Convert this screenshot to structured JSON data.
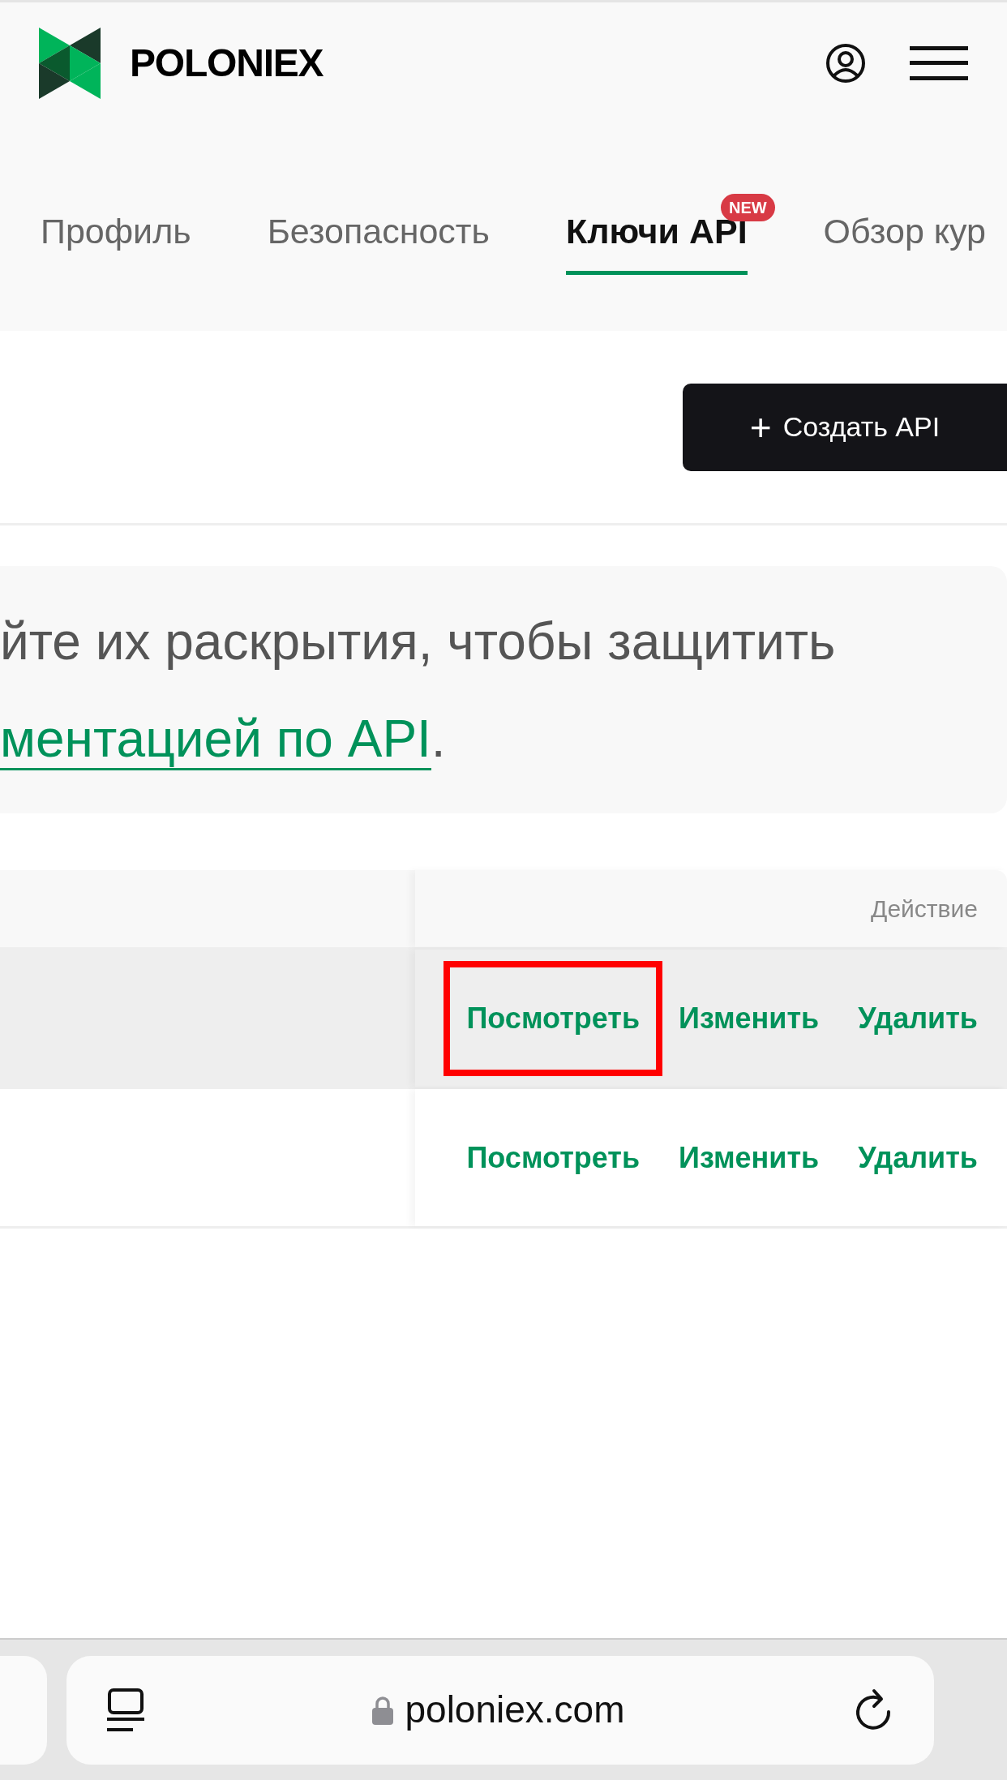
{
  "header": {
    "logo_text": "POLONIEX"
  },
  "tabs": [
    {
      "label": "Профиль",
      "selected": false
    },
    {
      "label": "Безопасность",
      "selected": false
    },
    {
      "label": "Ключи API",
      "selected": true,
      "badge": "NEW"
    },
    {
      "label": "Обзор кур",
      "selected": false
    }
  ],
  "create_button": {
    "icon": "+",
    "label": "Создать API"
  },
  "notice": {
    "line_1": "йте их раскрытия, чтобы защитить",
    "link": "ментацией по API",
    "line_2_end": "."
  },
  "table": {
    "columns": [
      "Действие"
    ],
    "rows": [
      {
        "highlighted": true,
        "actions": [
          {
            "label": "Посмотреть",
            "marked": true
          },
          {
            "label": "Изменить",
            "marked": false
          },
          {
            "label": "Удалить",
            "marked": false
          }
        ]
      },
      {
        "highlighted": false,
        "actions": [
          {
            "label": "Посмотреть",
            "marked": false
          },
          {
            "label": "Изменить",
            "marked": false
          },
          {
            "label": "Удалить",
            "marked": false
          }
        ]
      }
    ]
  },
  "browser_bar": {
    "url": "poloniex.com"
  }
}
